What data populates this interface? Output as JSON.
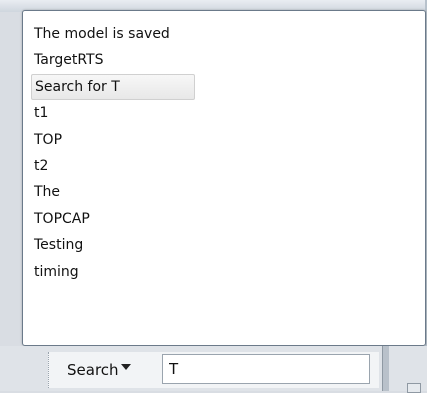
{
  "popup": {
    "items": [
      {
        "label": "The model is saved"
      },
      {
        "label": "TargetRTS"
      },
      {
        "label": "Search for T",
        "selected": true
      },
      {
        "label": "t1"
      },
      {
        "label": "TOP"
      },
      {
        "label": "t2"
      },
      {
        "label": "The"
      },
      {
        "label": "TOPCAP"
      },
      {
        "label": "Testing"
      },
      {
        "label": "timing"
      }
    ]
  },
  "toolbar": {
    "search_label": "Search",
    "dropdown_icon": "triangle-down",
    "search_value": "T"
  }
}
